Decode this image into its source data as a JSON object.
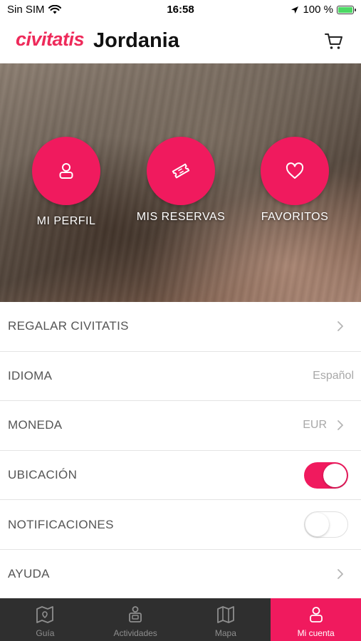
{
  "status_bar": {
    "carrier": "Sin SIM",
    "time": "16:58",
    "battery": "100 %"
  },
  "header": {
    "logo": "civitatis",
    "title": "Jordania"
  },
  "hero": {
    "items": [
      {
        "label": "MI PERFIL",
        "icon": "user-icon"
      },
      {
        "label": "MIS RESERVAS",
        "icon": "ticket-icon"
      },
      {
        "label": "FAVORITOS",
        "icon": "heart-icon"
      }
    ]
  },
  "menu": {
    "gift": {
      "label": "REGALAR CIVITATIS"
    },
    "language": {
      "label": "IDIOMA",
      "value": "Español"
    },
    "currency": {
      "label": "MONEDA",
      "value": "EUR"
    },
    "location": {
      "label": "UBICACIÓN",
      "enabled": true
    },
    "notifications": {
      "label": "NOTIFICACIONES",
      "enabled": false
    },
    "help": {
      "label": "AYUDA"
    }
  },
  "tabbar": {
    "tabs": [
      {
        "label": "Guía",
        "icon": "guide-map-icon"
      },
      {
        "label": "Actividades",
        "icon": "activities-icon"
      },
      {
        "label": "Mapa",
        "icon": "map-icon"
      },
      {
        "label": "Mi cuenta",
        "icon": "account-icon",
        "active": true
      }
    ]
  },
  "colors": {
    "accent": "#f01a5e",
    "tabbar_bg": "#2f2f2f"
  }
}
